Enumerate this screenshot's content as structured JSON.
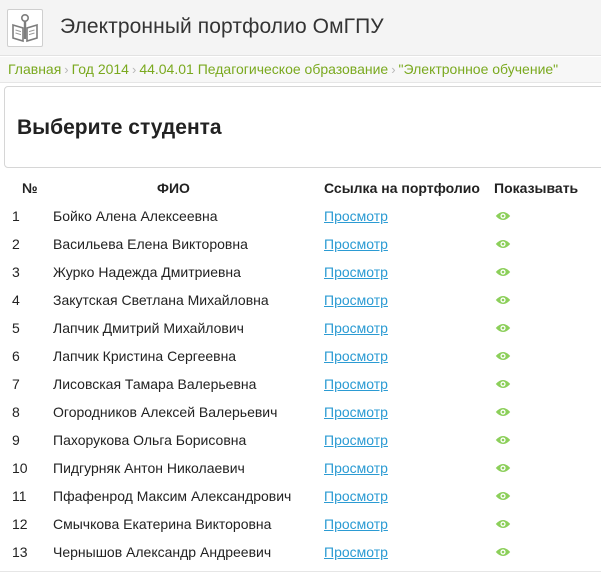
{
  "header": {
    "title": "Электронный портфолио ОмГПУ",
    "logo_icon": "book-logo-icon"
  },
  "breadcrumb": [
    "Главная",
    "Год 2014",
    "44.04.01 Педагогическое образование",
    "\"Электронное обучение\""
  ],
  "breadcrumb_separator": "›",
  "panel": {
    "title": "Выберите студента"
  },
  "table": {
    "headers": {
      "num": "№",
      "fio": "ФИО",
      "link": "Ссылка на портфолио",
      "show": "Показывать"
    },
    "rows": [
      {
        "num": "1",
        "fio": "Бойко Алена Алексеевна",
        "link": "Просмотр"
      },
      {
        "num": "2",
        "fio": "Васильева Елена Викторовна",
        "link": "Просмотр"
      },
      {
        "num": "3",
        "fio": "Журко Надежда Дмитриевна",
        "link": "Просмотр"
      },
      {
        "num": "4",
        "fio": "Закутская Светлана Михайловна",
        "link": "Просмотр"
      },
      {
        "num": "5",
        "fio": "Лапчик Дмитрий Михайлович",
        "link": "Просмотр"
      },
      {
        "num": "6",
        "fio": "Лапчик Кристина Сергеевна",
        "link": "Просмотр"
      },
      {
        "num": "7",
        "fio": "Лисовская Тамара Валерьевна",
        "link": "Просмотр"
      },
      {
        "num": "8",
        "fio": "Огородников Алексей Валерьевич",
        "link": "Просмотр"
      },
      {
        "num": "9",
        "fio": "Пахорукова Ольга Борисовна",
        "link": "Просмотр"
      },
      {
        "num": "10",
        "fio": "Пидгурняк Антон Николаевич",
        "link": "Просмотр"
      },
      {
        "num": "11",
        "fio": "Пфафенрод Максим Александрович",
        "link": "Просмотр"
      },
      {
        "num": "12",
        "fio": "Смычкова Екатерина Викторовна",
        "link": "Просмотр"
      },
      {
        "num": "13",
        "fio": "Чернышов Александр Андреевич",
        "link": "Просмотр"
      }
    ]
  },
  "colors": {
    "accent_green": "#7aa91f",
    "link_blue": "#2b9bd3",
    "eye_green": "#8ccf5a"
  }
}
